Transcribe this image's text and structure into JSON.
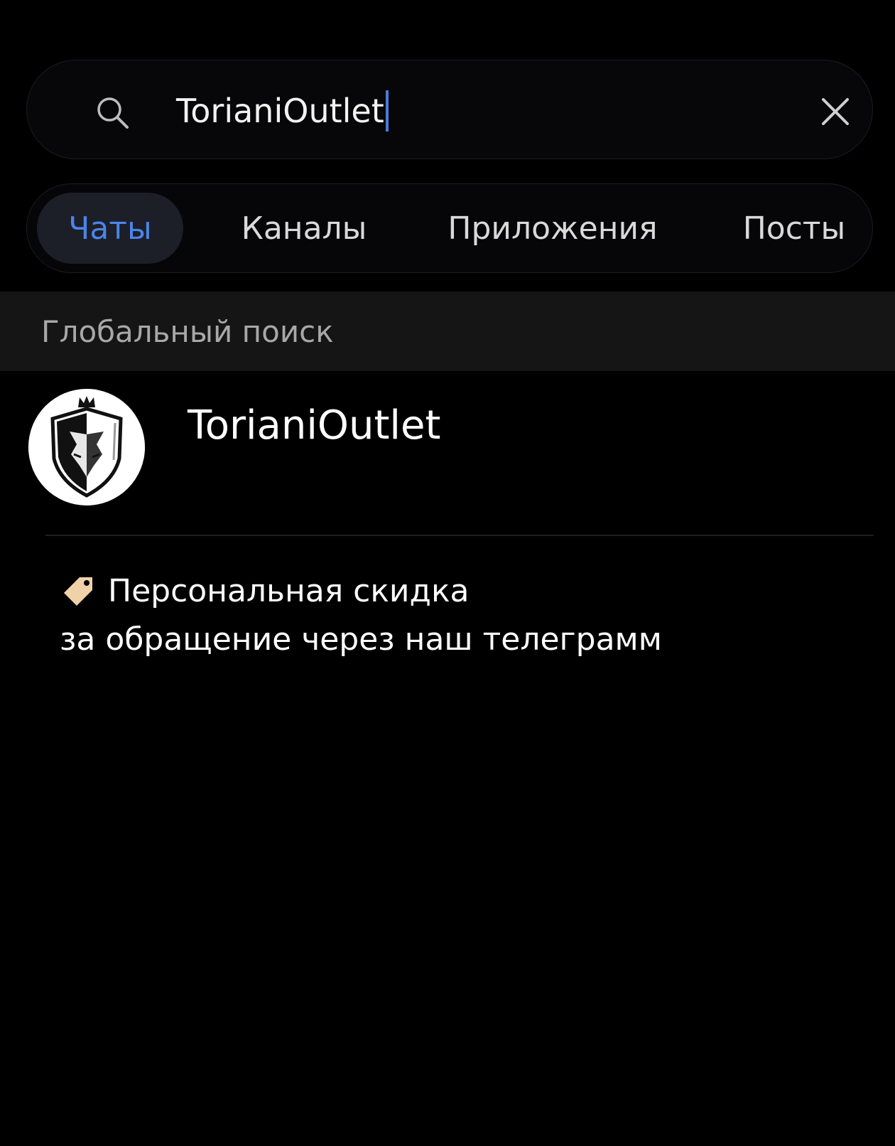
{
  "search": {
    "value": "TorianiOutlet",
    "clear_icon": "close-icon",
    "search_icon": "search-icon"
  },
  "tabs": [
    {
      "label": "Чаты",
      "active": true
    },
    {
      "label": "Каналы",
      "active": false
    },
    {
      "label": "Приложения",
      "active": false
    },
    {
      "label": "Посты",
      "active": false
    }
  ],
  "section": {
    "title": "Глобальный поиск"
  },
  "results": [
    {
      "title": "TorianiOutlet",
      "avatar_icon": "wolf-shield-logo"
    }
  ],
  "promo": {
    "icon": "tag-icon",
    "line1": "Персональная скидка",
    "line2": "за обращение через наш телеграмм"
  },
  "colors": {
    "background": "#000000",
    "accent": "#4c84e8",
    "section_header_bg": "#151515",
    "tag_icon": "#f0d2a8"
  }
}
